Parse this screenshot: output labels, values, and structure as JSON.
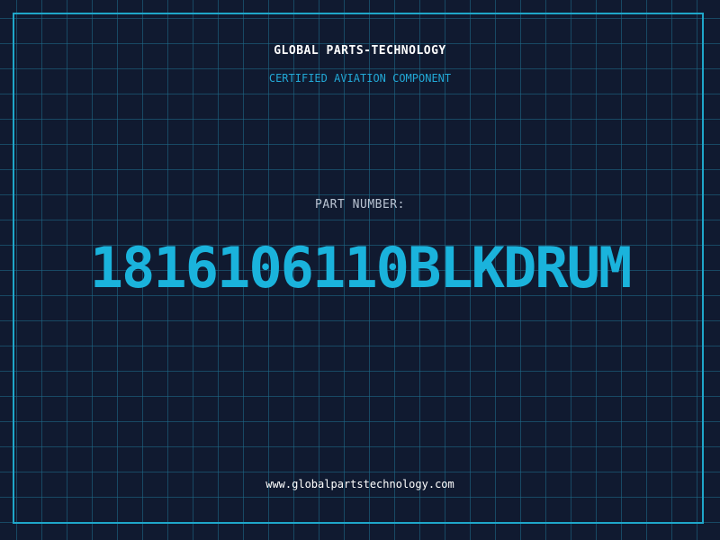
{
  "header": {
    "company": "GLOBAL PARTS-TECHNOLOGY",
    "tagline": "CERTIFIED AVIATION COMPONENT"
  },
  "part": {
    "label": "PART NUMBER:",
    "number": "1816106110BLKDRUM"
  },
  "footer": {
    "url": "www.globalpartstechnology.com"
  },
  "colors": {
    "background": "#101a30",
    "grid": "#1e6e8c",
    "accent": "#1ab3dc",
    "frame": "#1fa6c9",
    "label": "#b9c3d2",
    "text": "#ffffff"
  }
}
